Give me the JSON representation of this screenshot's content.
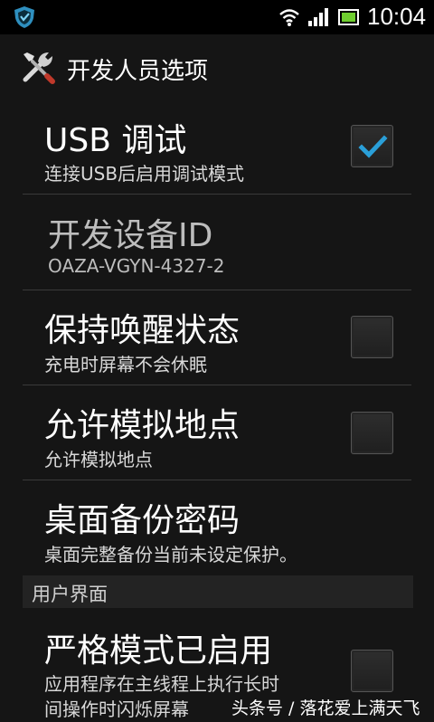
{
  "status_bar": {
    "time": "10:04"
  },
  "header": {
    "title": "开发人员选项"
  },
  "items": [
    {
      "title": "USB 调试",
      "summary": "连接USB后启用调试模式"
    },
    {
      "title": "开发设备ID",
      "summary": "OAZA-VGYN-4327-2"
    },
    {
      "title": "保持唤醒状态",
      "summary": "充电时屏幕不会休眠"
    },
    {
      "title": "允许模拟地点",
      "summary": "允许模拟地点"
    },
    {
      "title": "桌面备份密码",
      "summary": "桌面完整备份当前未设定保护。"
    }
  ],
  "section": {
    "label": "用户界面"
  },
  "item_strict": {
    "title": "严格模式已启用",
    "summary_line1": "应用程序在主线程上执行长时",
    "summary_line2": "间操作时闪烁屏幕"
  },
  "watermark": "头条号 / 落花爱上满天飞"
}
